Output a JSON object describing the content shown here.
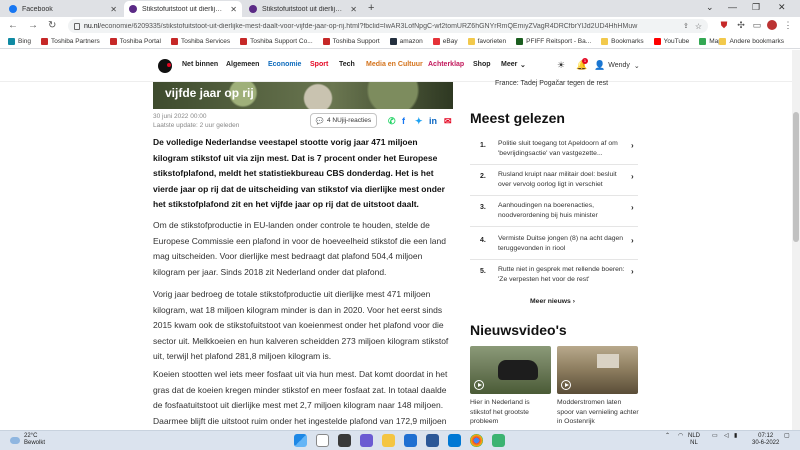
{
  "browser": {
    "tabs": [
      {
        "label": "Facebook",
        "color": "#1877f2",
        "active": false
      },
      {
        "label": "Stikstofuitstoot uit dierlijke mest",
        "color": "#5b2a86",
        "active": true
      },
      {
        "label": "Stikstofuitstoot uit dierlijke mest",
        "color": "#5b2a86",
        "active": false
      }
    ],
    "new_tab": "+",
    "url_host": "nu.nl",
    "url_path": "/economie/6209335/stikstofuitstoot-uit-dierlijke-mest-daalt-voor-vijfde-jaar-op-rij.html?fbclid=IwAR3LofNpgC-wf2tomURZ6hGNYrRmQEmiyZVagR4DRCfbrYlJd2UD4HhHMuw",
    "bookmarks": [
      {
        "label": "Bing",
        "color": "#0f8aa3"
      },
      {
        "label": "Toshiba Partners",
        "color": "#c62828"
      },
      {
        "label": "Toshiba Portal",
        "color": "#c62828"
      },
      {
        "label": "Toshiba Services",
        "color": "#c62828"
      },
      {
        "label": "Toshiba Support Co...",
        "color": "#c62828"
      },
      {
        "label": "Toshiba Support",
        "color": "#c62828"
      },
      {
        "label": "amazon",
        "color": "#232f3e"
      },
      {
        "label": "eBay",
        "color": "#e53238"
      },
      {
        "label": "favorieten",
        "color": "#f2c94c"
      },
      {
        "label": "PFIFF Reitsport - Ba...",
        "color": "#1b5e20"
      },
      {
        "label": "Bookmarks",
        "color": "#f2c94c"
      },
      {
        "label": "YouTube",
        "color": "#ff0000"
      },
      {
        "label": "Maps",
        "color": "#34a853"
      }
    ],
    "other_bookmarks": "Andere bookmarks"
  },
  "site": {
    "nav": [
      "Net binnen",
      "Algemeen",
      "Economie",
      "Sport",
      "Tech",
      "Media en Cultuur",
      "Achterklap",
      "Shop",
      "Meer"
    ],
    "nav_colors": [
      "#222222",
      "#222222",
      "#0f6cbd",
      "#e40521",
      "#222222",
      "#d4731c",
      "#c2185b",
      "#222222",
      "#222222"
    ],
    "user": "Wendy",
    "notification_count": "1"
  },
  "article": {
    "hero_caption": "vijfde jaar op rij",
    "date": "30 juni 2022 00:00",
    "updated": "Laatste update: 2 uur geleden",
    "reactions": "4 NUjij-reacties",
    "intro": "De volledige Nederlandse veestapel stootte vorig jaar 471 miljoen kilogram stikstof uit via zijn mest. Dat is 7 procent onder het Europese stikstofplafond, meldt het statistiekbureau CBS donderdag. Het is het vierde jaar op rij dat de uitscheiding van stikstof via dierlijke mest onder het stikstofplafond zit en het vijfde jaar op rij dat de uitstoot daalt.",
    "paragraphs": [
      "Om de stikstofproductie in EU-landen onder controle te houden, stelde de Europese Commissie een plafond in voor de hoeveelheid stikstof die een land mag uitscheiden. Voor dierlijke mest bedraagt dat plafond 504,4 miljoen kilogram per jaar. Sinds 2018 zit Nederland onder dat plafond.",
      "Vorig jaar bedroeg de totale stikstofproductie uit dierlijke mest 471 miljoen kilogram, wat 18 miljoen kilogram minder is dan in 2020. Voor het eerst sinds 2015 kwam ook de stikstofuitstoot van koeienmest onder het plafond voor die sector uit. Melkkoeien en hun kalveren scheidden 273 miljoen kilogram stikstof uit, terwijl het plafond 281,8 miljoen kilogram is.",
      "Koeien stootten wel iets meer fosfaat uit via hun mest. Dat komt doordat in het gras dat de koeien kregen minder stikstof en meer fosfaat zat. In totaal daalde de fosfaatuitstoot uit dierlijke mest met 2,7 miljoen kilogram naar 148 miljoen. Daarmee blijft die uitstoot ruim onder het ingestelde plafond van 172,9 miljoen"
    ]
  },
  "sidebar": {
    "teaser": "France: Tadej Pogačar tegen de rest",
    "most_read_title": "Meest gelezen",
    "most_read": [
      {
        "num": "1.",
        "text": "Politie sluit toegang tot Apeldoorn af om 'bevrijdingsactie' van vastgezette..."
      },
      {
        "num": "2.",
        "text": "Rusland kruipt naar militair doel: besluit over vervolg oorlog ligt in verschiet"
      },
      {
        "num": "3.",
        "text": "Aanhoudingen na boerenacties, noodverordening bij huis minister"
      },
      {
        "num": "4.",
        "text": "Vermiste Duitse jongen (8) na acht dagen teruggevonden in riool"
      },
      {
        "num": "5.",
        "text": "Rutte niet in gesprek met rellende boeren: 'Ze verpesten het voor de rest'"
      }
    ],
    "more_news": "Meer nieuws",
    "videos_title": "Nieuwsvideo's",
    "videos": [
      {
        "text": "Hier in Nederland is stikstof het grootste probleem"
      },
      {
        "text": "Modderstromen laten spoor van vernieling achter in Oostenrijk"
      }
    ]
  },
  "taskbar": {
    "temp": "22°C",
    "weather": "Bewolkt",
    "lang1": "NLD",
    "lang2": "NL",
    "time": "07:12",
    "date": "30-6-2022"
  }
}
